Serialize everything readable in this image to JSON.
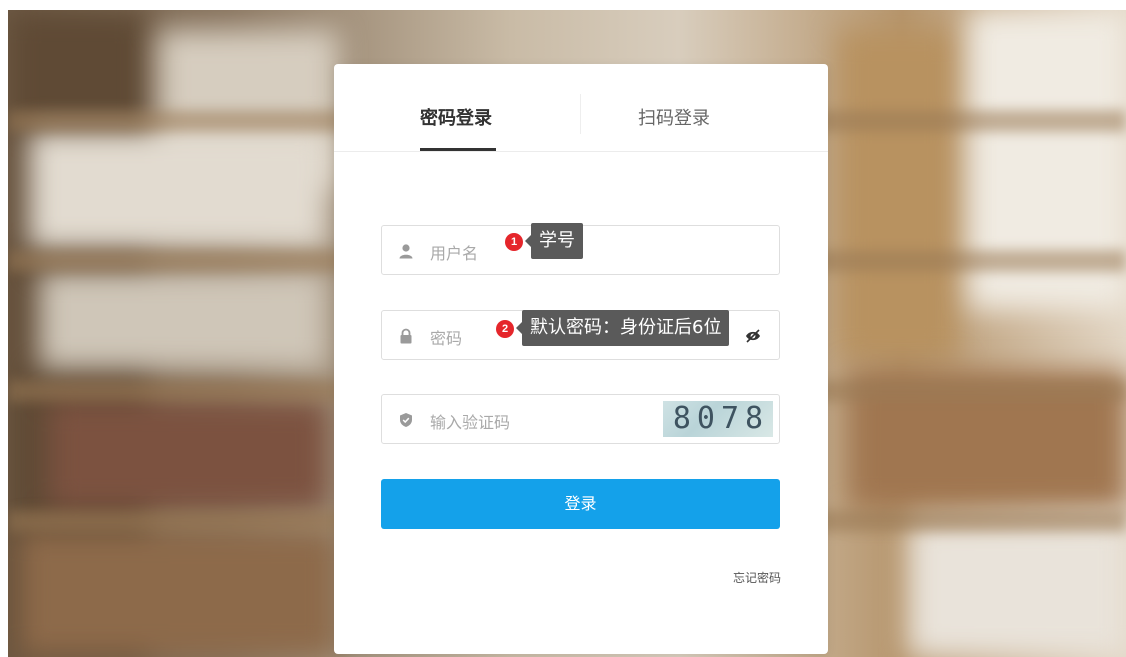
{
  "tabs": {
    "password_login": "密码登录",
    "qr_login": "扫码登录"
  },
  "form": {
    "username_placeholder": "用户名",
    "password_placeholder": "密码",
    "captcha_placeholder": "输入验证码",
    "captcha_text": "8078",
    "login_button": "登录",
    "forgot_password": "忘记密码"
  },
  "annotations": [
    {
      "number": "1",
      "text": "学号"
    },
    {
      "number": "2",
      "text": "默认密码：身份证后6位"
    }
  ],
  "icons": {
    "username": "user-icon",
    "password": "lock-icon",
    "captcha": "shield-icon",
    "toggle_visibility": "eye-icon"
  },
  "colors": {
    "primary": "#14a1ea",
    "badge": "#e5262b",
    "tooltip": "#5a5a5a"
  }
}
